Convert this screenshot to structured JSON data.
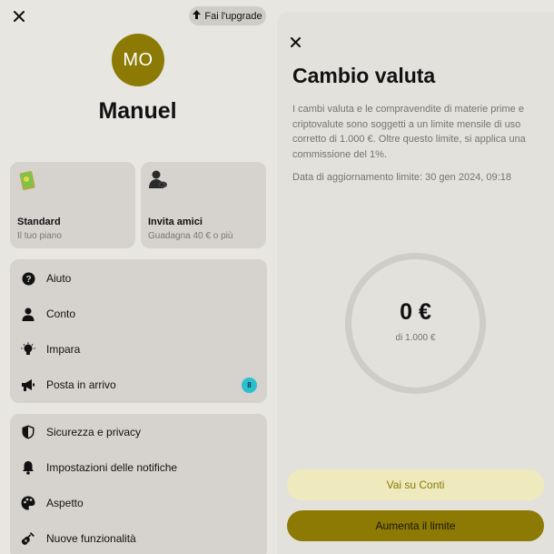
{
  "left_panel": {
    "upgrade_label": "Fai l'upgrade",
    "avatar_initials": "MO",
    "user_name": "Manuel",
    "cards": [
      {
        "title": "Standard",
        "subtitle": "Il tuo piano"
      },
      {
        "title": "Invita amici",
        "subtitle": "Guadagna 40 € o più"
      }
    ],
    "menu_group_1": [
      {
        "label": "Aiuto",
        "icon": "help-icon"
      },
      {
        "label": "Conto",
        "icon": "person-icon"
      },
      {
        "label": "Impara",
        "icon": "lightbulb-icon"
      },
      {
        "label": "Posta in arrivo",
        "icon": "megaphone-icon",
        "badge": "8"
      }
    ],
    "menu_group_2": [
      {
        "label": "Sicurezza e privacy",
        "icon": "shield-icon"
      },
      {
        "label": "Impostazioni delle notifiche",
        "icon": "bell-icon"
      },
      {
        "label": "Aspetto",
        "icon": "palette-icon"
      },
      {
        "label": "Nuove funzionalità",
        "icon": "guitar-icon"
      }
    ]
  },
  "right_panel": {
    "title": "Cambio valuta",
    "description": "I cambi valuta e le compravendite di materie prime e criptovalute sono soggetti a un limite mensile di uso corretto di 1.000 €. Oltre questo limite, si applica una commissione del 1%.",
    "update_date": "Data di aggiornamento limite: 30 gen 2024, 09:18",
    "amount": "0 €",
    "amount_limit": "di 1.000 €",
    "secondary_button": "Vai su Conti",
    "primary_button": "Aumenta il limite"
  },
  "colors": {
    "accent": "#8c7a05",
    "accent_light": "#eeeabd",
    "badge": "#2bbfcf",
    "background": "#e8e6e1"
  }
}
